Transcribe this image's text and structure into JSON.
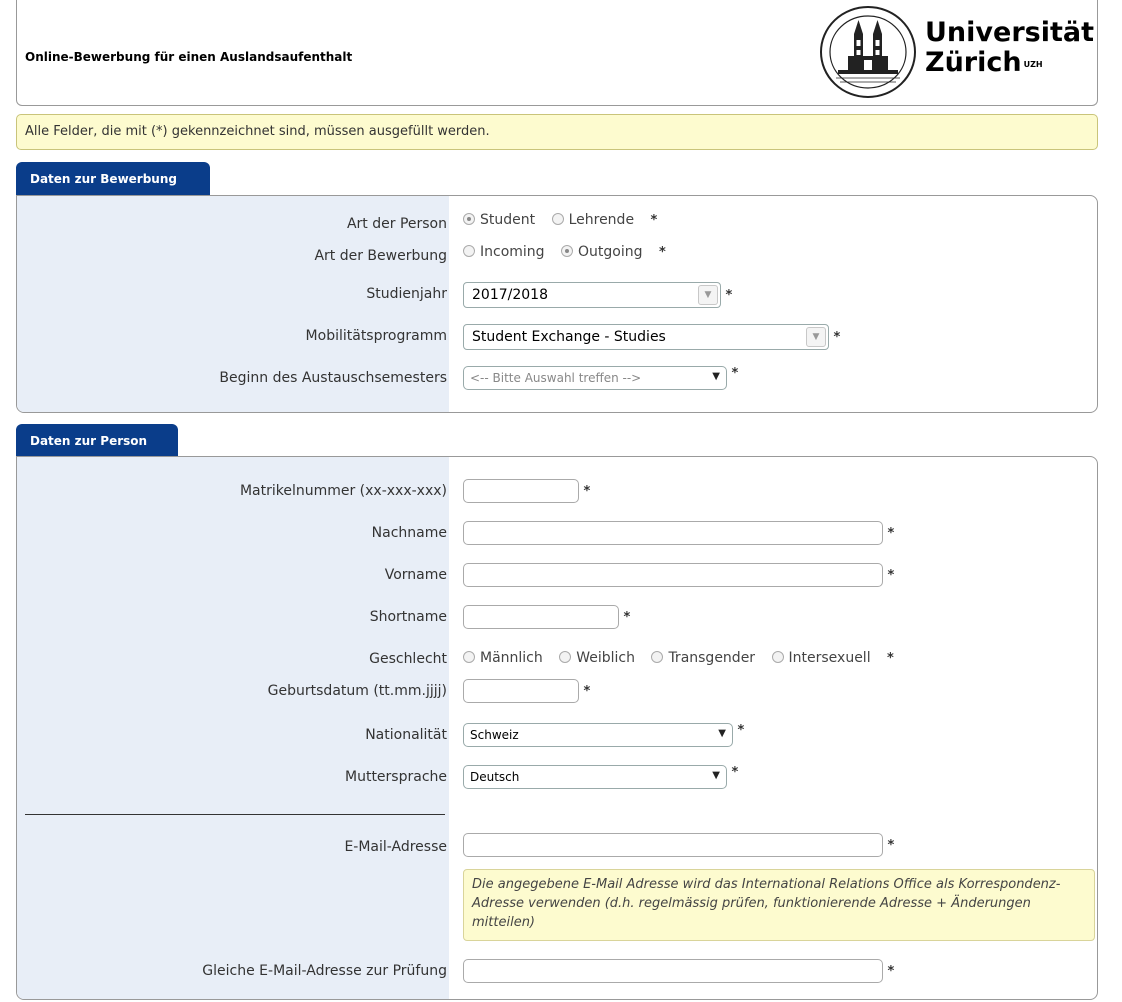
{
  "header": {
    "title": "Online-Bewerbung für einen Auslandsaufenthalt",
    "logo_line1": "Universität",
    "logo_line2": "Zürich",
    "logo_sup": "UZH"
  },
  "notice": "Alle Felder, die mit (*) gekennzeichnet sind, müssen ausgefüllt werden.",
  "required_marker": "*",
  "bewerbung": {
    "tab_label": "Daten zur Bewerbung",
    "art_person": {
      "label": "Art der Person",
      "options": [
        "Student",
        "Lehrende"
      ],
      "selected": "Student"
    },
    "art_bewerbung": {
      "label": "Art der Bewerbung",
      "options": [
        "Incoming",
        "Outgoing"
      ],
      "selected": "Outgoing"
    },
    "studienjahr": {
      "label": "Studienjahr",
      "value": "2017/2018"
    },
    "mobilitaet": {
      "label": "Mobilitätsprogramm",
      "value": "Student Exchange - Studies"
    },
    "beginn": {
      "label": "Beginn des Austauschsemesters",
      "placeholder": "<-- Bitte Auswahl treffen -->"
    }
  },
  "person": {
    "tab_label": "Daten zur Person",
    "matrikel": {
      "label": "Matrikelnummer (xx-xxx-xxx)",
      "value": ""
    },
    "nachname": {
      "label": "Nachname",
      "value": ""
    },
    "vorname": {
      "label": "Vorname",
      "value": ""
    },
    "shortname": {
      "label": "Shortname",
      "value": ""
    },
    "geschlecht": {
      "label": "Geschlecht",
      "options": [
        "Männlich",
        "Weiblich",
        "Transgender",
        "Intersexuell"
      ],
      "selected": ""
    },
    "geburtsdatum": {
      "label": "Geburtsdatum (tt.mm.jjjj)",
      "value": ""
    },
    "nationalitaet": {
      "label": "Nationalität",
      "value": "Schweiz"
    },
    "muttersprache": {
      "label": "Muttersprache",
      "value": "Deutsch"
    },
    "email": {
      "label": "E-Mail-Adresse",
      "value": ""
    },
    "email_hint": "Die angegebene E-Mail Adresse wird das International Relations Office als Korrespondenz-Adresse verwenden (d.h. regelmässig prüfen, funktionierende Adresse + Änderungen mitteilen)",
    "email_confirm": {
      "label": "Gleiche E-Mail-Adresse zur Prüfung",
      "value": ""
    }
  },
  "colors": {
    "tab": "#0a3d8a",
    "label_bg": "#e8eef7",
    "notice_bg": "#fdfbcf"
  }
}
